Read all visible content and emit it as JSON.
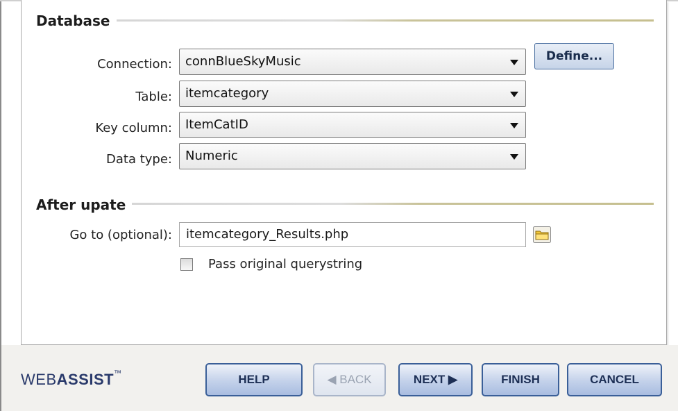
{
  "sections": {
    "database_title": "Database",
    "after_update_title": "After upate"
  },
  "fields": {
    "connection": {
      "label": "Connection:",
      "value": "connBlueSkyMusic"
    },
    "table": {
      "label": "Table:",
      "value": "itemcategory"
    },
    "key_column": {
      "label": "Key column:",
      "value": "ItemCatID"
    },
    "data_type": {
      "label": "Data type:",
      "value": "Numeric"
    },
    "go_to": {
      "label": "Go to (optional):",
      "value": "itemcategory_Results.php"
    },
    "pass_querystring": {
      "label": "Pass original querystring",
      "checked": false
    }
  },
  "buttons": {
    "define": "Define...",
    "help": "HELP",
    "back": "◀ BACK",
    "next": "NEXT ▶",
    "finish": "FINISH",
    "cancel": "CANCEL"
  },
  "footer": {
    "logo_plain": "WEB",
    "logo_bold": "ASSIST",
    "logo_tm": "™"
  },
  "icons": {
    "folder": "folder-icon",
    "dropdown": "chevron-down-icon"
  }
}
